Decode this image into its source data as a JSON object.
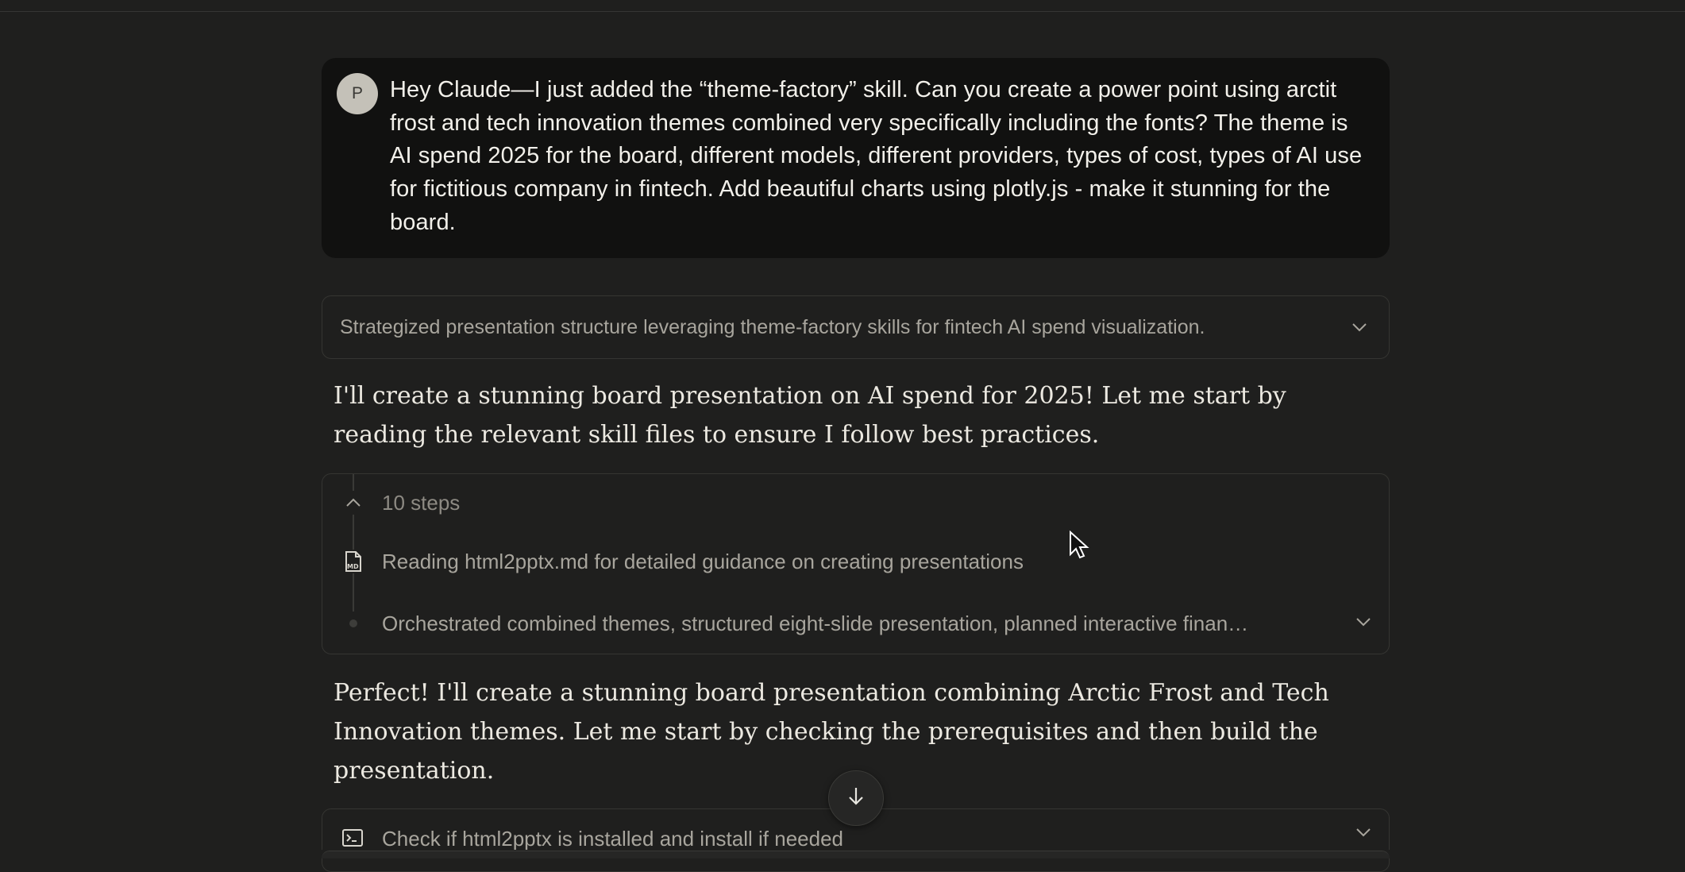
{
  "user_message": {
    "avatar_initial": "P",
    "text": "Hey Claude—I just added the “theme-factory” skill. Can you create a power point using arctit frost and tech innovation themes combined very specifically including the fonts? The theme is AI spend 2025 for the board, different models, different providers, types of cost, types of AI use for fictitious company in fintech. Add beautiful charts using plotly.js - make it stunning for the board."
  },
  "thought_summary": {
    "text": "Strategized presentation structure leveraging theme-factory skills for fintech AI spend visualization.",
    "icon": "chevron-down-icon"
  },
  "assistant": {
    "paragraph_1": "I'll create a stunning board presentation on AI spend for 2025! Let me start by reading the relevant skill files to ensure I follow best practices.",
    "paragraph_2": "Perfect! I'll create a stunning board presentation combining Arctic Frost and Tech Innovation themes. Let me start by checking the prerequisites and then build the presentation."
  },
  "steps": {
    "count_label": "10 steps",
    "items": [
      {
        "label": "Reading html2pptx.md for detailed guidance on creating presentations",
        "icon": "markdown-file-icon"
      },
      {
        "label": "Orchestrated combined themes, structured eight-slide presentation, planned interactive finan…",
        "icon": "dot-icon"
      }
    ]
  },
  "tool_call": {
    "label": "Check if html2pptx is installed and install if needed",
    "icon": "terminal-icon"
  },
  "scroll_button": {
    "icon": "arrow-down-icon"
  }
}
